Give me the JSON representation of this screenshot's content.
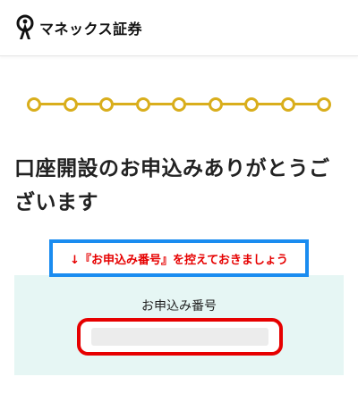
{
  "header": {
    "logo_text": "マネックス証券",
    "logo_icon": "monex-logo-icon"
  },
  "progress": {
    "total_steps": 9,
    "completed_steps": 9,
    "color": "#d9ae1c"
  },
  "main": {
    "title": "口座開設のお申込みありがとうございます",
    "notice": "↓『お申込み番号』を控えておきましょう",
    "application_number_label": "お申込み番号",
    "application_number_value": ""
  },
  "colors": {
    "notice_border": "#1a8cf0",
    "notice_text": "#e60000",
    "panel_bg": "#e6f6f4",
    "highlight_border": "#e60000"
  }
}
